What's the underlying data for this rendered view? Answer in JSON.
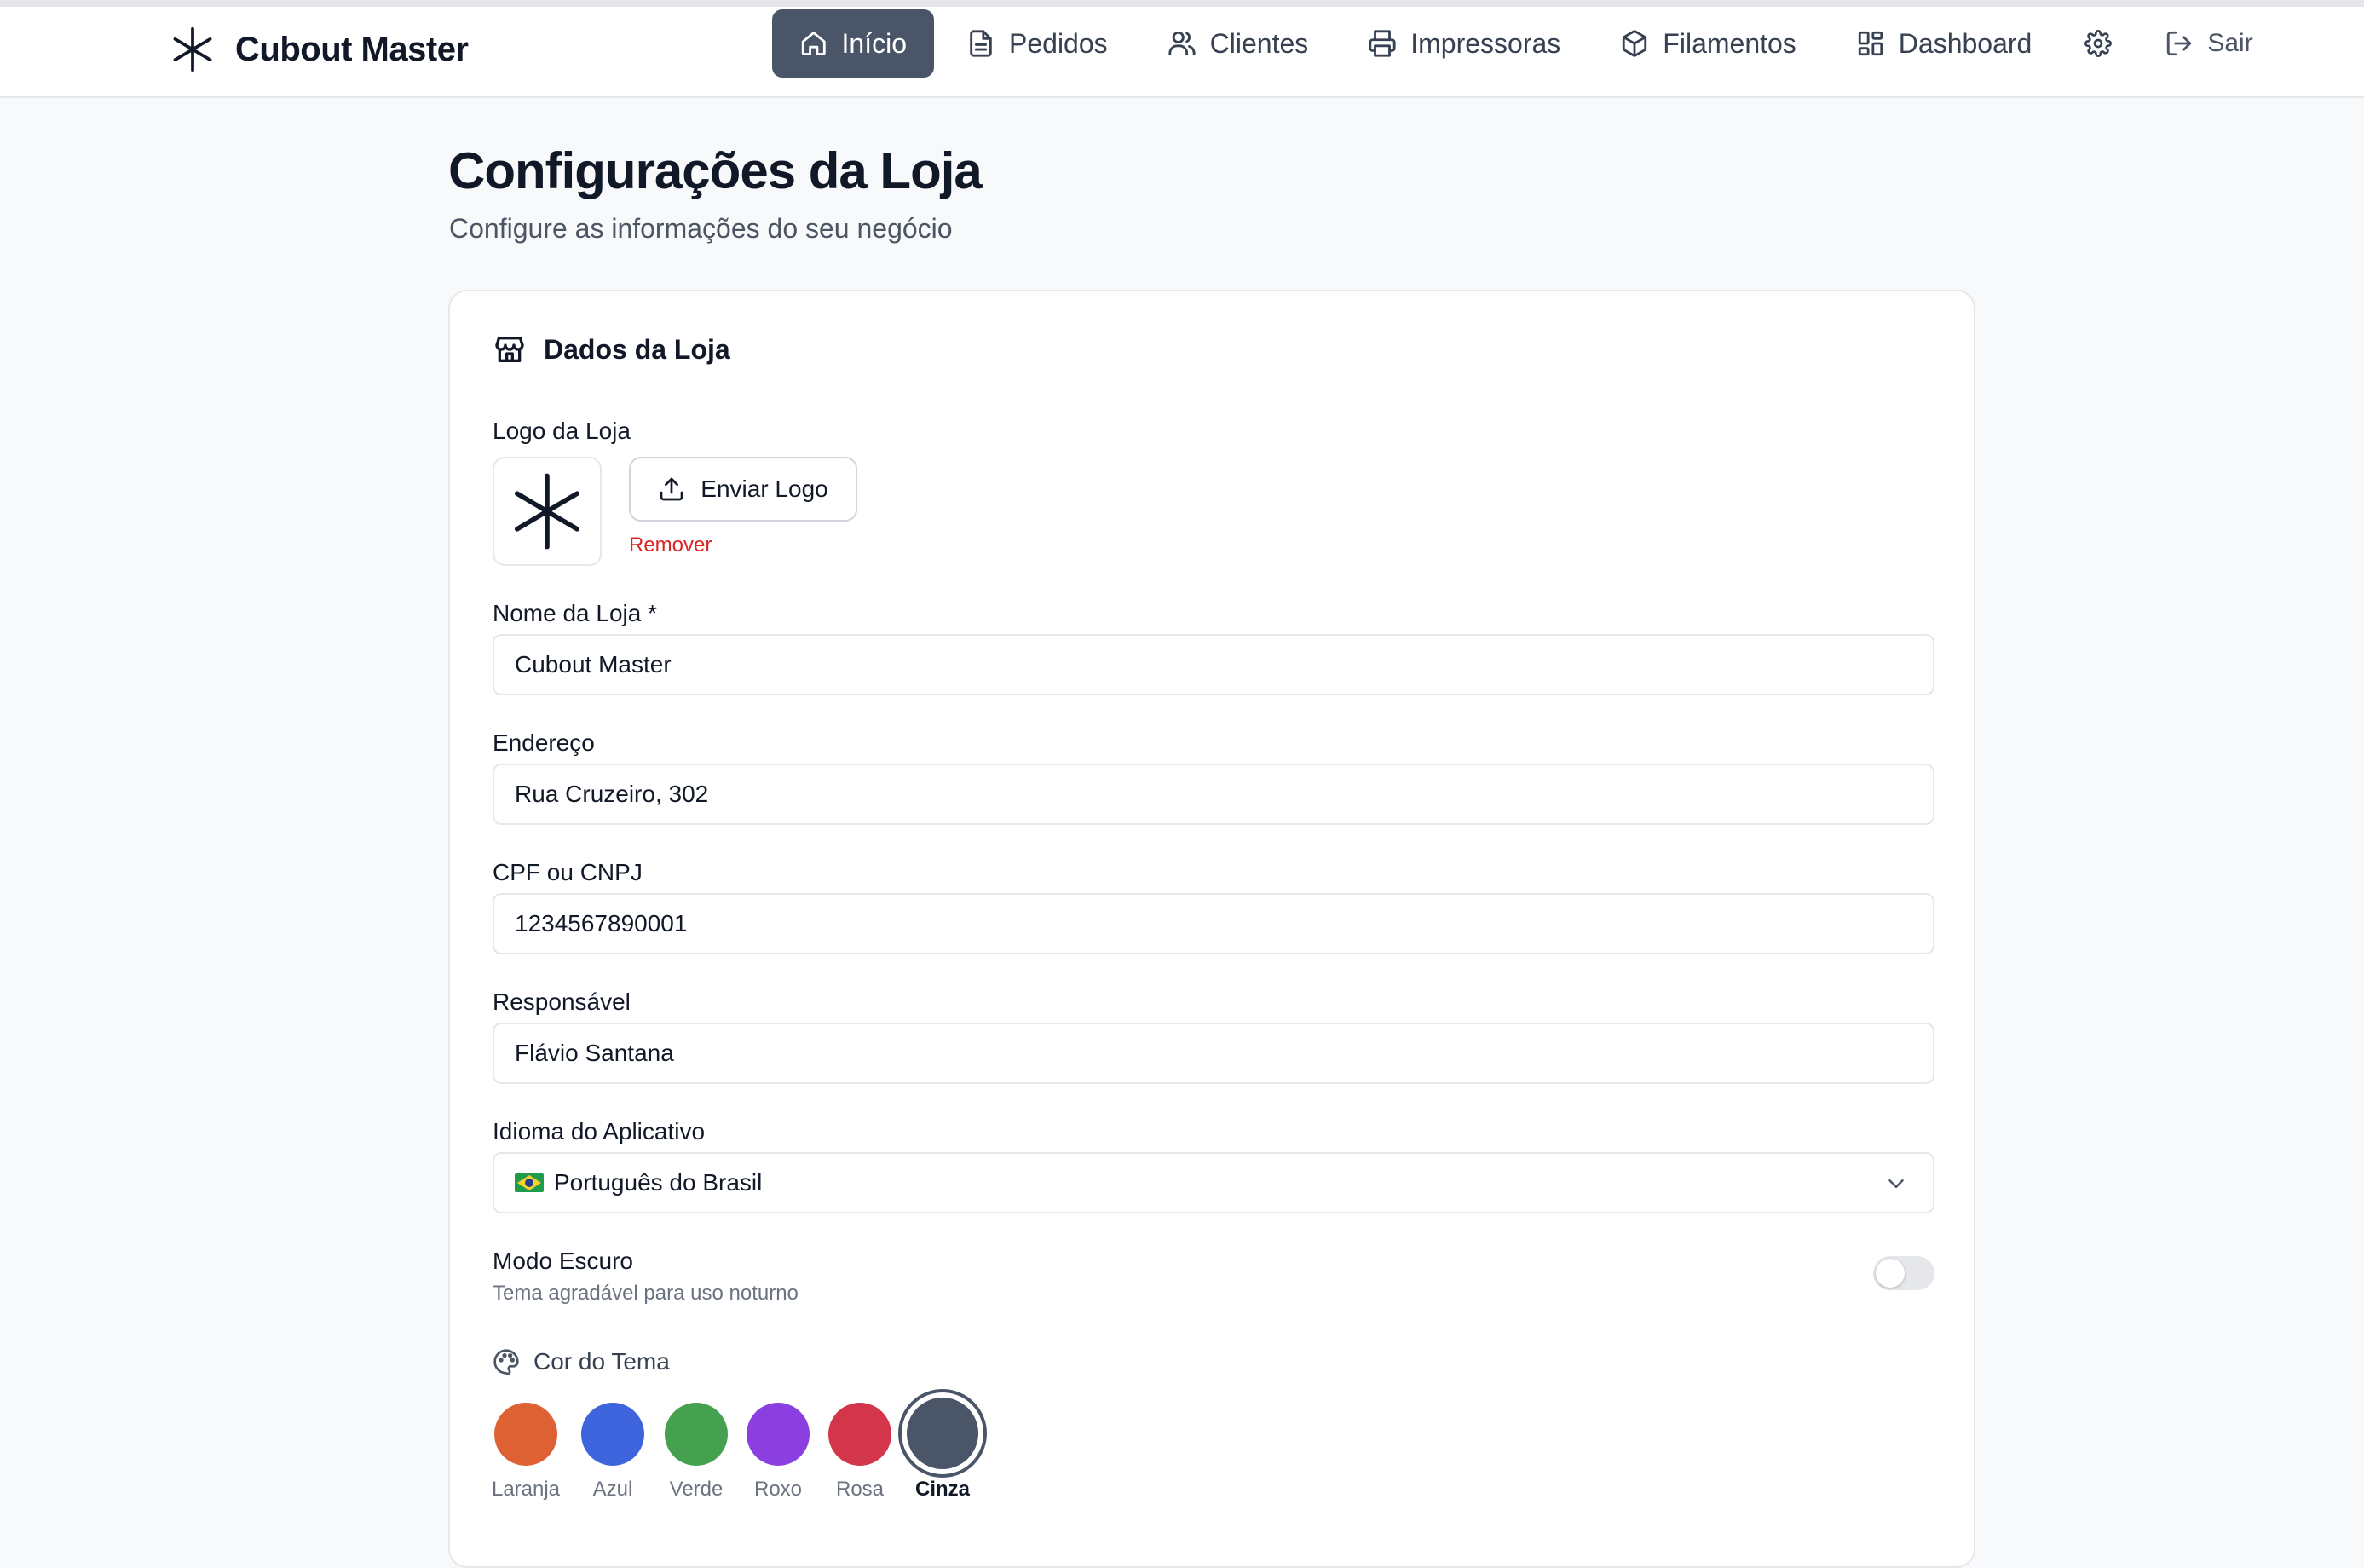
{
  "brand": {
    "name": "Cubout Master"
  },
  "nav": {
    "items": [
      {
        "label": "Início",
        "icon": "home-icon",
        "active": true
      },
      {
        "label": "Pedidos",
        "icon": "file-text-icon"
      },
      {
        "label": "Clientes",
        "icon": "users-icon"
      },
      {
        "label": "Impressoras",
        "icon": "printer-icon"
      },
      {
        "label": "Filamentos",
        "icon": "box-icon"
      },
      {
        "label": "Dashboard",
        "icon": "grid-icon"
      }
    ],
    "settings_icon": "gear-icon",
    "logout_label": "Sair"
  },
  "page": {
    "title": "Configurações da Loja",
    "subtitle": "Configure as informações do seu negócio"
  },
  "card": {
    "title": "Dados da Loja",
    "logo": {
      "label": "Logo da Loja",
      "upload_label": "Enviar Logo",
      "remove_label": "Remover"
    },
    "fields": {
      "store_name": {
        "label": "Nome da Loja *",
        "value": "Cubout Master"
      },
      "address": {
        "label": "Endereço",
        "value": "Rua Cruzeiro, 302"
      },
      "document": {
        "label": "CPF ou CNPJ",
        "value": "1234567890001"
      },
      "owner": {
        "label": "Responsável",
        "value": "Flávio Santana"
      },
      "language": {
        "label": "Idioma do Aplicativo",
        "value": "Português do Brasil"
      }
    },
    "dark_mode": {
      "label": "Modo Escuro",
      "helper": "Tema agradável para uso noturno",
      "enabled": false
    },
    "theme": {
      "label": "Cor do Tema",
      "colors": [
        {
          "name": "Laranja",
          "hex": "#dd6132"
        },
        {
          "name": "Azul",
          "hex": "#3d63dd"
        },
        {
          "name": "Verde",
          "hex": "#45a14f"
        },
        {
          "name": "Roxo",
          "hex": "#8b3fe0"
        },
        {
          "name": "Rosa",
          "hex": "#d3364a"
        },
        {
          "name": "Cinza",
          "hex": "#4a5568",
          "selected": true
        }
      ]
    }
  }
}
